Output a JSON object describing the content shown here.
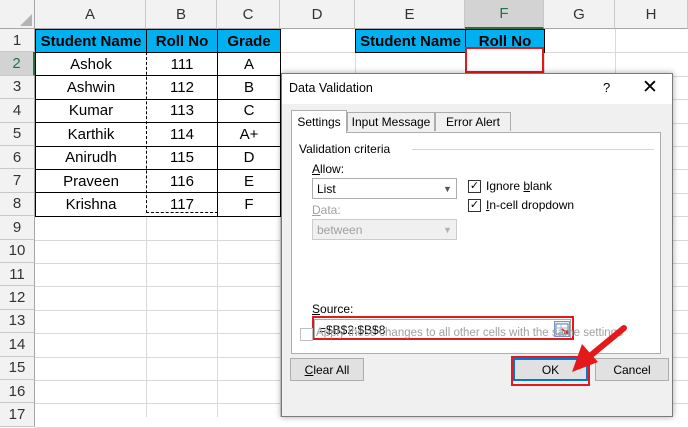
{
  "spreadsheet": {
    "columns": [
      "A",
      "B",
      "C",
      "D",
      "E",
      "F",
      "G",
      "H"
    ],
    "rows": [
      "1",
      "2",
      "3",
      "4",
      "5",
      "6",
      "7",
      "8",
      "9",
      "10",
      "11",
      "12",
      "13",
      "14",
      "15",
      "16",
      "17"
    ],
    "selected_column": "F",
    "selected_row": "2",
    "table": {
      "headers": [
        "Student Name",
        "Roll No",
        "Grade"
      ],
      "rows": [
        [
          "Ashok",
          "111",
          "A"
        ],
        [
          "Ashwin",
          "112",
          "B"
        ],
        [
          "Kumar",
          "113",
          "C"
        ],
        [
          "Karthik",
          "114",
          "A+"
        ],
        [
          "Anirudh",
          "115",
          "D"
        ],
        [
          "Praveen",
          "116",
          "E"
        ],
        [
          "Krishna",
          "117",
          "F"
        ]
      ]
    },
    "lookup_headers": [
      "Student Name",
      "Roll No"
    ],
    "colors": {
      "header_fill": "#00b0f0",
      "highlight": "#e3191c"
    }
  },
  "dialog": {
    "title": "Data Validation",
    "help": "?",
    "close": "✕",
    "tabs": [
      "Settings",
      "Input Message",
      "Error Alert"
    ],
    "active_tab": "Settings",
    "group_label": "Validation criteria",
    "allow_label": "Allow:",
    "allow_value": "List",
    "data_label": "Data:",
    "data_value": "between",
    "ignore_blank": {
      "label": "Ignore blank",
      "checked": true
    },
    "in_cell_dropdown": {
      "label": "In-cell dropdown",
      "checked": true
    },
    "source_label": "Source:",
    "source_value": "=$B$2:$B$8",
    "apply_all": {
      "label": "Apply these changes to all other cells with the same settings",
      "checked": false
    },
    "buttons": {
      "clear_all": "Clear All",
      "ok": "OK",
      "cancel": "Cancel"
    }
  }
}
